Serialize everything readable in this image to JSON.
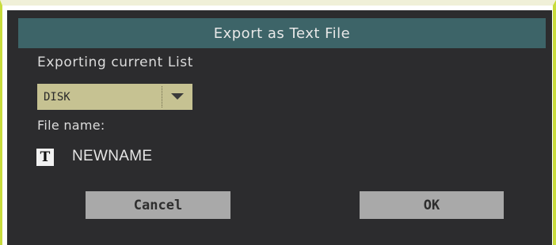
{
  "dialog": {
    "title": "Export as Text File",
    "subtitle": "Exporting current List",
    "destination": {
      "selected": "DISK",
      "arrow_icon": "triangle-down-icon"
    },
    "file_name": {
      "label": "File name:",
      "edit_icon_glyph": "T",
      "value": "NEWNAME"
    },
    "buttons": {
      "cancel": "Cancel",
      "ok": "OK"
    }
  },
  "colors": {
    "dialog_bg": "#2c2c2e",
    "titlebar_bg": "#3d6468",
    "dropdown_bg": "#c6c292",
    "button_bg": "#a9a9a9",
    "frame_accent": "#c8dc3c"
  }
}
